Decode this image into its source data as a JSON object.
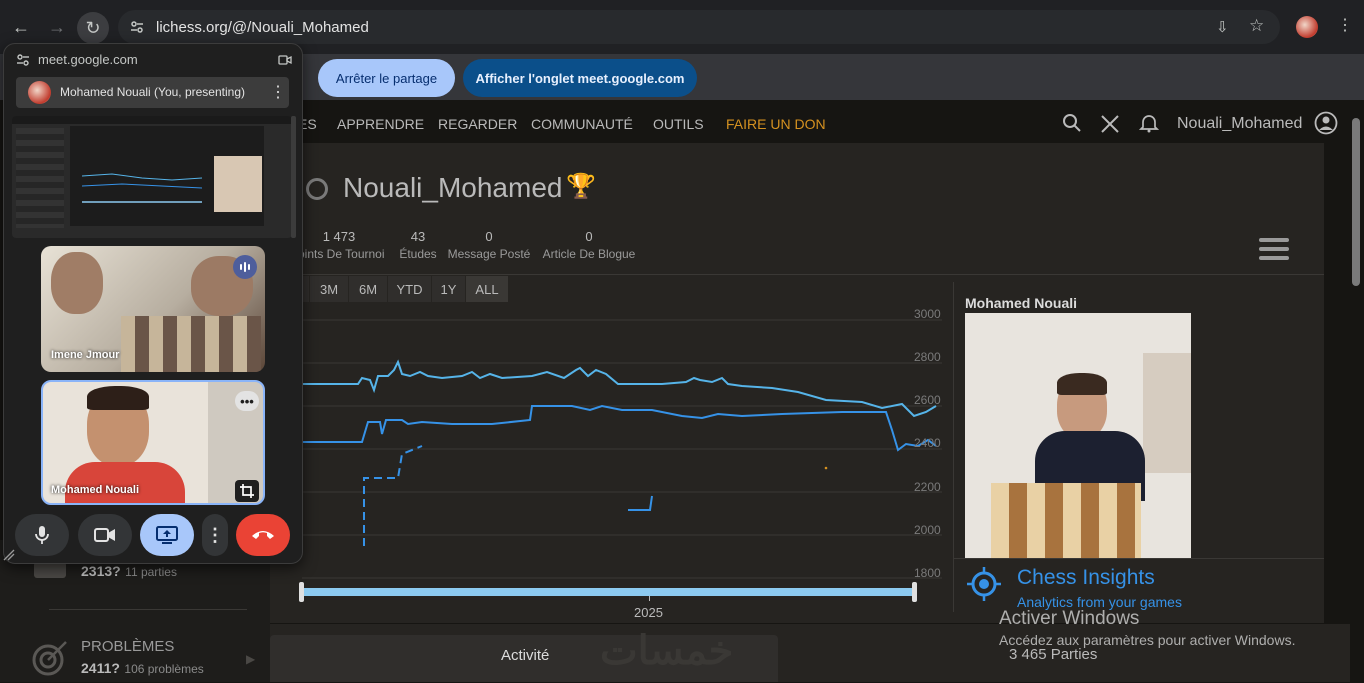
{
  "browser": {
    "url": "lichess.org/@/Nouali_Mohamed"
  },
  "share_bar": {
    "stop_label": "Arrêter le partage",
    "show_tab_label": "Afficher l'onglet meet.google.com"
  },
  "site": {
    "menu": [
      "ES",
      "APPRENDRE",
      "REGARDER",
      "COMMUNAUTÉ",
      "OUTILS",
      "FAIRE UN DON"
    ],
    "username": "Nouali_Mohamed",
    "profile_title": "Nouali_Mohamed",
    "trophy": "🏆",
    "stats": [
      {
        "num": "1 473",
        "label": "oints De Tournoi"
      },
      {
        "num": "43",
        "label": "Études"
      },
      {
        "num": "0",
        "label": "Message Posté"
      },
      {
        "num": "0",
        "label": "Article De Blogue"
      }
    ],
    "ranges": [
      "3M",
      "6M",
      "YTD",
      "1Y",
      "ALL"
    ],
    "y_ticks": [
      "3000",
      "2800",
      "2600",
      "2400",
      "2200",
      "2000",
      "1800"
    ],
    "x_label": "2025",
    "card_name": "Mohamed Nouali",
    "insights_title": "Chess Insights",
    "insights_sub": "Analytics from your games",
    "left_rating": "2313?",
    "left_rating_games": "11 parties",
    "puzzles_label": "PROBLÈMES",
    "puzzles_rating": "2411?",
    "puzzles_count": "106 problèmes",
    "activity_tab": "Activité",
    "games_count": "3 465 Parties",
    "watermark_title": "Activer Windows",
    "watermark_sub": "Accédez aux paramètres pour activer Windows.",
    "logo_text": "خمسات"
  },
  "meet": {
    "domain": "meet.google.com",
    "presenter": "Mohamed Nouali (You, presenting)",
    "participants": [
      {
        "name": "Imene Jmour"
      },
      {
        "name": "Mohamed Nouali"
      }
    ]
  },
  "colors": {
    "accent_blue": "#3692e7",
    "lichess_orange": "#d59120",
    "end_call_red": "#ea4335",
    "share_blue": "#a8c7fa"
  }
}
